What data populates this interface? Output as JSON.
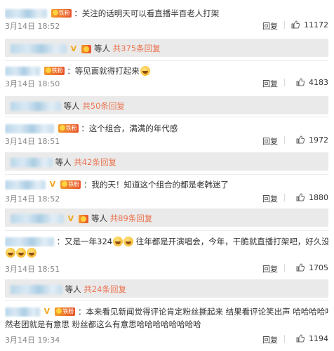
{
  "reply_label": "回复",
  "comments": [
    {
      "text": "：关注的话明天可以看直播半百老人打架",
      "time": "3月14日 18:52",
      "likes": "11172",
      "sub": {
        "people": "等人",
        "more": "共375条回复"
      }
    },
    {
      "text": "：等见面就得打起来",
      "time": "3月14日 18:50",
      "likes": "4183",
      "sub": {
        "people": "等人",
        "more": "共50条回复"
      }
    },
    {
      "text": "：这个组合，满满的年代感",
      "time": "3月14日 18:51",
      "likes": "1972",
      "sub": {
        "people": "等人",
        "more": "共42条回复"
      }
    },
    {
      "text": "：我的天！知道这个组合的都是老韩迷了",
      "time": "3月14日 18:52",
      "likes": "1880",
      "sub": {
        "people": "等人",
        "more": "共89条回复"
      }
    },
    {
      "text": "：又是一年324",
      "text2": "往年都是开演唱会，今年，干脆就直播打架吧，好久没看过了",
      "time": "3月14日 18:51",
      "likes": "1705",
      "sub": {
        "people": "等人",
        "more": "共24条回复"
      }
    },
    {
      "text": "：本来看见新闻觉得评论肯定粉丝撕起来  结果看评论笑出声   哈哈哈哈哈哈哈果",
      "text2": "然老团就是有意思  粉丝都这么有意思哈哈哈哈哈哈哈哈",
      "time": "3月14日 19:34",
      "likes": "1194"
    }
  ],
  "badges": {
    "fan": "铁粉"
  },
  "colors": {
    "link": "#eb7350",
    "sub_bg": "#eaeaea",
    "meta": "#888888"
  }
}
